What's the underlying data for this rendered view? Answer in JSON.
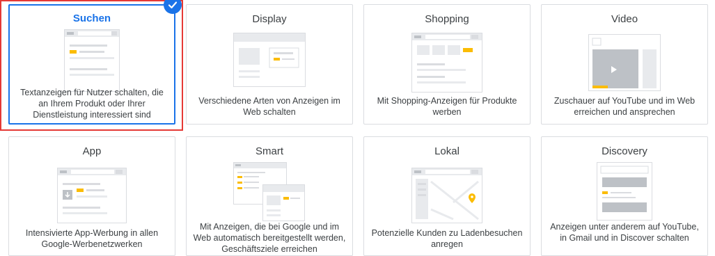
{
  "campaign_types": [
    {
      "id": "search",
      "title": "Suchen",
      "description": "Textanzeigen für Nutzer schalten, die an Ihrem Produkt oder Ihrer Dienstleistung interessiert sind",
      "selected": true,
      "icon": "search-ads-illustration"
    },
    {
      "id": "display",
      "title": "Display",
      "description": "Verschiedene Arten von Anzeigen im Web schalten",
      "selected": false,
      "icon": "display-ads-illustration"
    },
    {
      "id": "shopping",
      "title": "Shopping",
      "description": "Mit Shopping-Anzeigen für Produkte werben",
      "selected": false,
      "icon": "shopping-ads-illustration"
    },
    {
      "id": "video",
      "title": "Video",
      "description": "Zuschauer auf YouTube und im Web erreichen und ansprechen",
      "selected": false,
      "icon": "video-ads-illustration"
    },
    {
      "id": "app",
      "title": "App",
      "description": "Intensivierte App-Werbung in allen Google-Werbenetzwerken",
      "selected": false,
      "icon": "app-ads-illustration"
    },
    {
      "id": "smart",
      "title": "Smart",
      "description": "Mit Anzeigen, die bei Google und im Web automatisch bereitgestellt werden, Geschäftsziele erreichen",
      "selected": false,
      "icon": "smart-ads-illustration"
    },
    {
      "id": "local",
      "title": "Lokal",
      "description": "Potenzielle Kunden zu Ladenbesuchen anregen",
      "selected": false,
      "icon": "local-ads-illustration"
    },
    {
      "id": "discovery",
      "title": "Discovery",
      "description": "Anzeigen unter anderem auf YouTube, in Gmail und in Discover schalten",
      "selected": false,
      "icon": "discovery-ads-illustration"
    }
  ],
  "colors": {
    "accent": "#1a73e8",
    "highlight_outline": "#e53935",
    "ad_marker": "#fbbc04",
    "border": "#dadce0"
  }
}
